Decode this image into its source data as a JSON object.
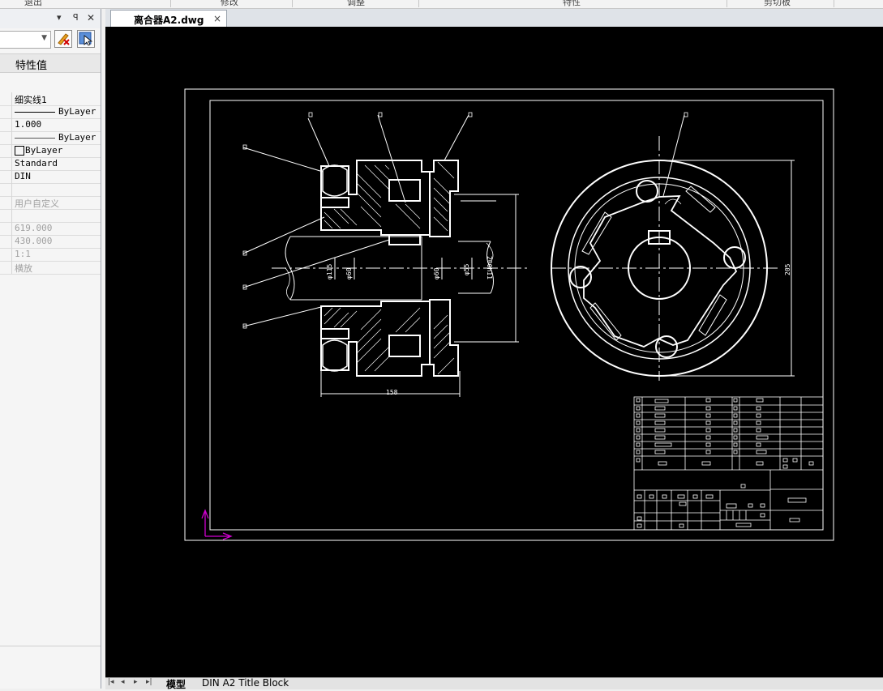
{
  "ribbon": {
    "labels": [
      "退出",
      "修改",
      "调整",
      "特性",
      "剪切板"
    ]
  },
  "properties_panel": {
    "header": "特性值",
    "rows": [
      {
        "value": "细实线1",
        "style": "normal"
      },
      {
        "value": "ByLayer",
        "style": "mono",
        "line": "thick"
      },
      {
        "value": "1.000",
        "style": "mono"
      },
      {
        "value": "ByLayer",
        "style": "mono",
        "line": "thin"
      },
      {
        "value": "ByLayer",
        "style": "mono",
        "swatch": true
      },
      {
        "value": "Standard",
        "style": "mono"
      },
      {
        "value": "DIN",
        "style": "mono"
      },
      {
        "value": "",
        "style": "normal"
      },
      {
        "value": "用户自定义",
        "style": "grey"
      },
      {
        "value": "",
        "style": "normal"
      },
      {
        "value": "619.000",
        "style": "grey-mono"
      },
      {
        "value": "430.000",
        "style": "grey-mono"
      },
      {
        "value": "1:1",
        "style": "grey-mono"
      },
      {
        "value": "横放",
        "style": "grey"
      }
    ]
  },
  "document_tab": {
    "title": "离合器A2.dwg",
    "close": "×"
  },
  "layout_tabs": {
    "nav": [
      "|◂",
      "◂",
      "▸",
      "▸|"
    ],
    "tabs": [
      "模型",
      "DIN A2 Title Block"
    ],
    "active": "模型"
  },
  "drawing": {
    "dimensions": [
      "φ115",
      "φ60",
      "φ60",
      "φ55",
      "200h11",
      "158",
      "205"
    ],
    "colors": {
      "background": "#000000",
      "lines": "#ffffff",
      "ucs": "#d000d0"
    }
  }
}
